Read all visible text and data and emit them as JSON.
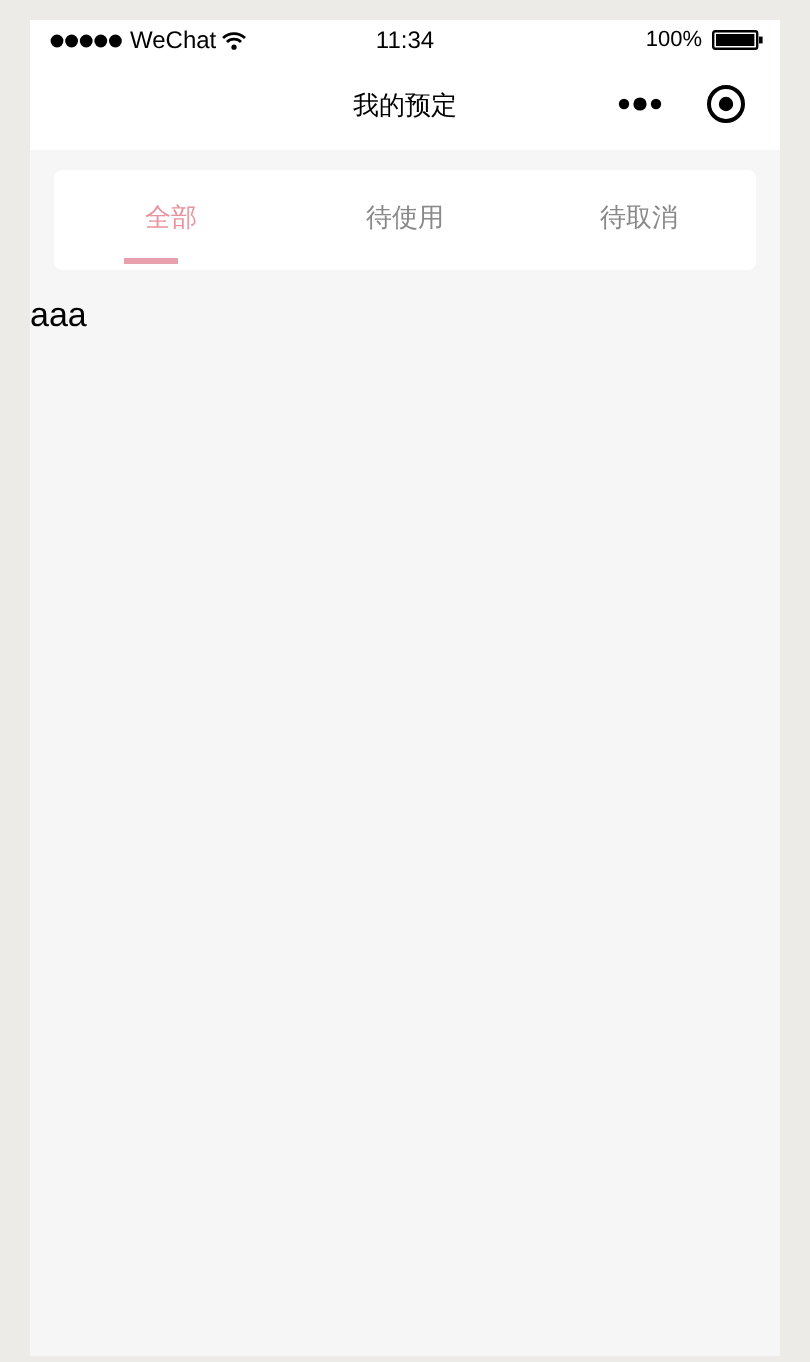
{
  "status_bar": {
    "carrier": "WeChat",
    "time": "11:34",
    "battery": "100%"
  },
  "nav_bar": {
    "title": "我的预定"
  },
  "tabs": [
    {
      "label": "全部",
      "selected": true
    },
    {
      "label": "待使用",
      "selected": false
    },
    {
      "label": "待取消",
      "selected": false
    }
  ],
  "content": {
    "text": "aaa"
  }
}
